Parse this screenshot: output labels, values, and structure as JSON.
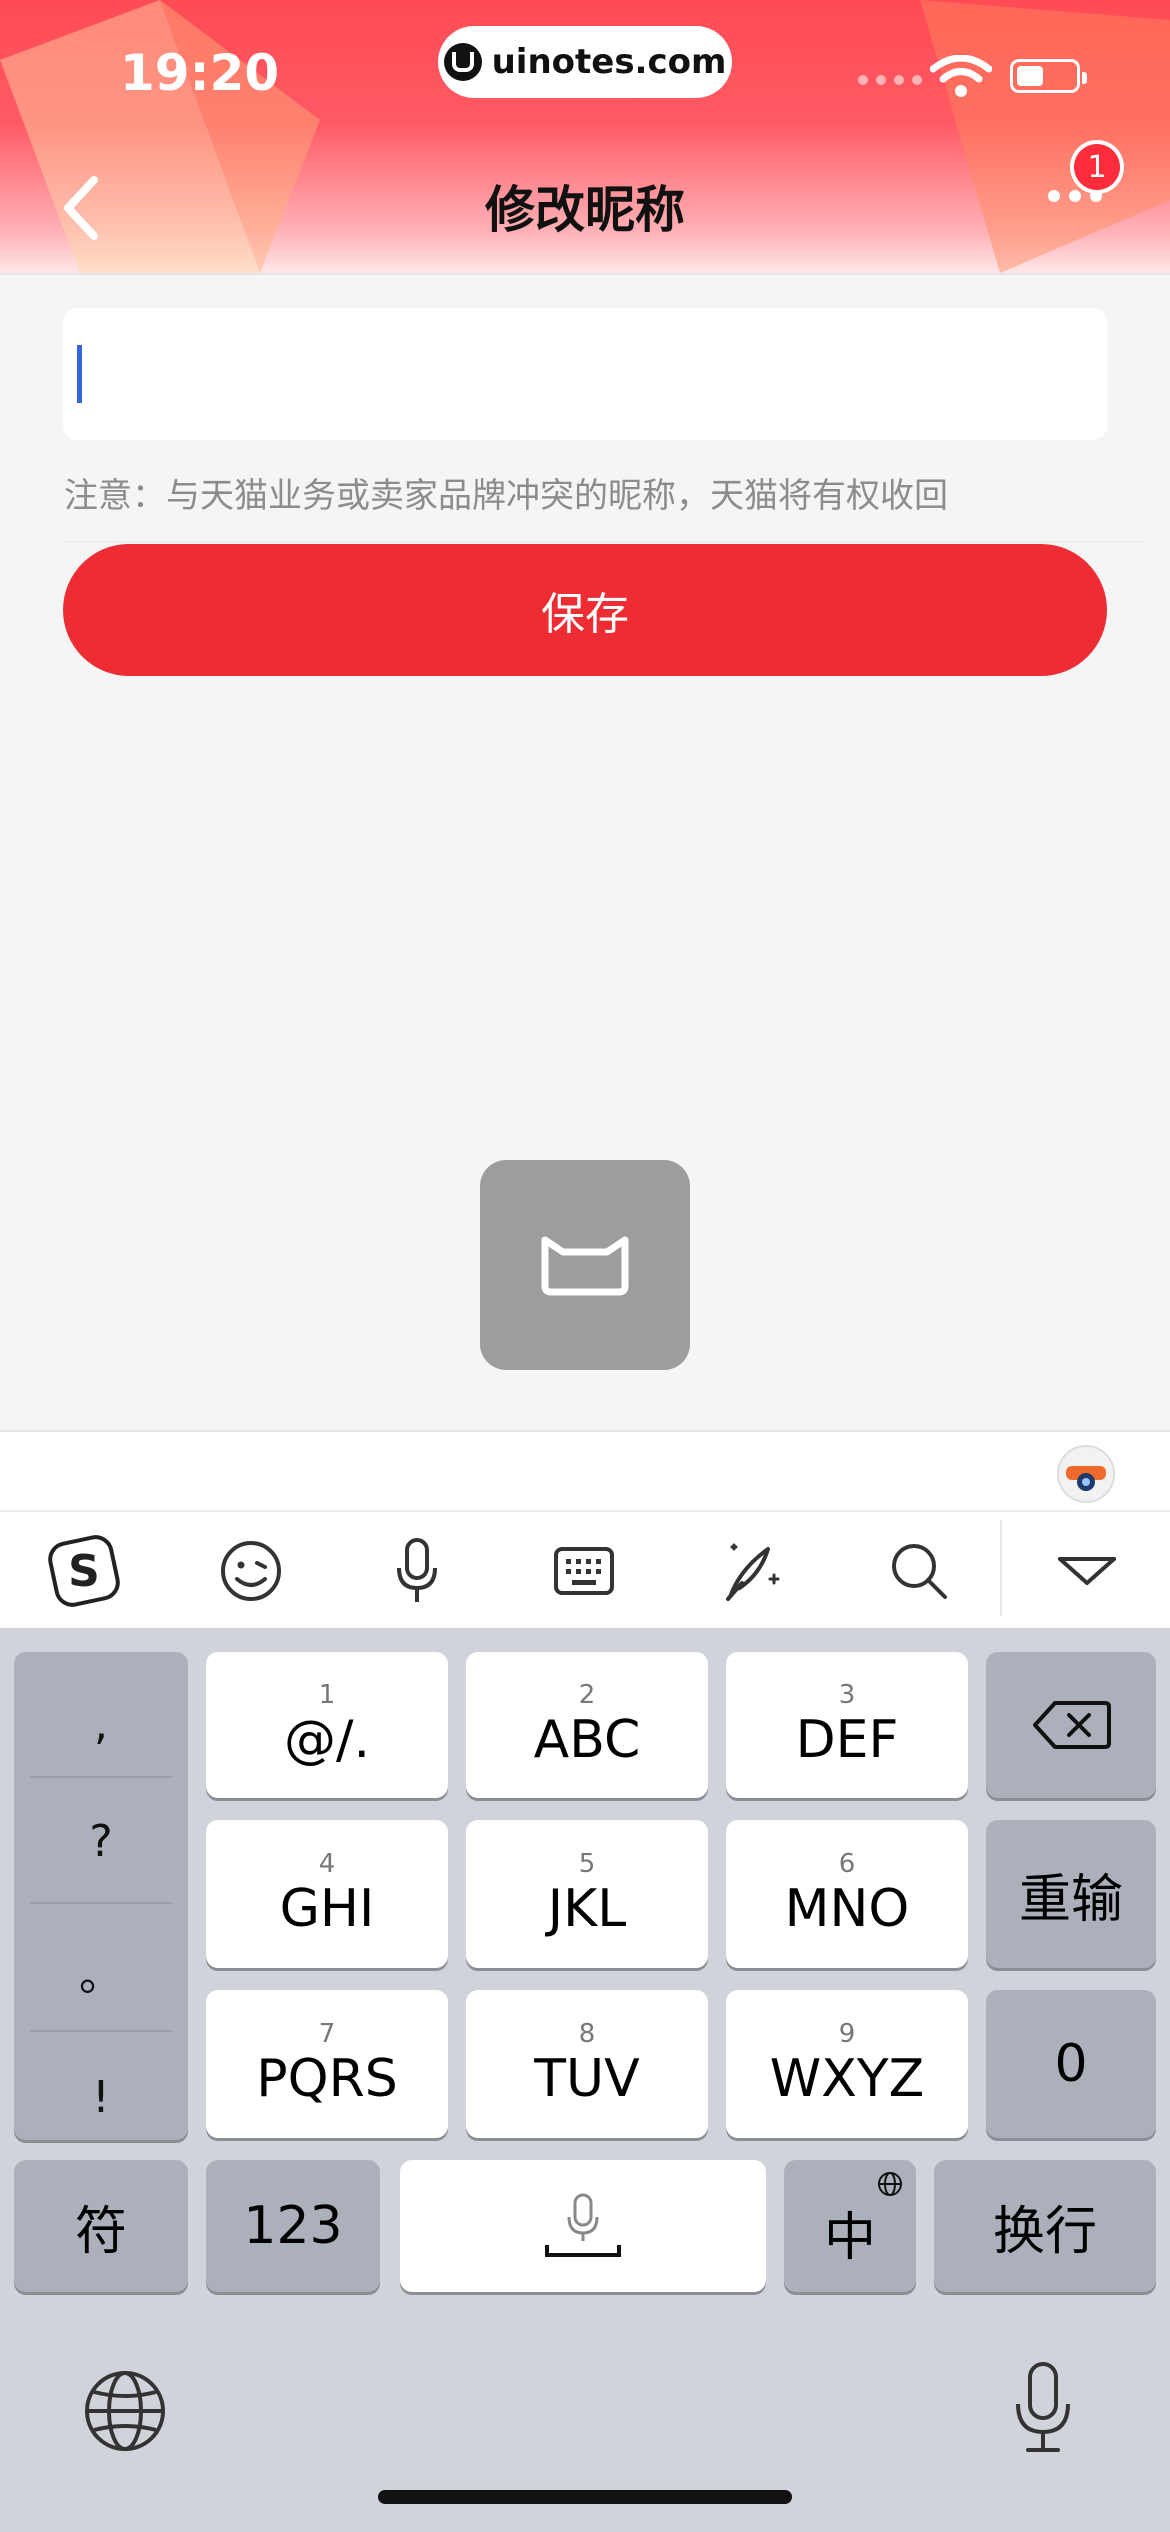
{
  "status_bar": {
    "time": "19:20",
    "url": "uinotes.com"
  },
  "nav": {
    "title": "修改昵称",
    "badge_count": "1"
  },
  "form": {
    "input_value": "",
    "input_placeholder": "",
    "note": "注意：与天猫业务或卖家品牌冲突的昵称，天猫将有权收回",
    "save_label": "保存"
  },
  "keyboard": {
    "toolbar_icons": [
      "sogou-logo-icon",
      "emoji-icon",
      "microphone-icon",
      "keyboard-icon",
      "handwriting-icon",
      "search-icon",
      "collapse-keyboard-icon"
    ],
    "punctuation": [
      ",",
      "?",
      "。",
      "!"
    ],
    "keys": [
      {
        "num": "1",
        "label": "@/."
      },
      {
        "num": "2",
        "label": "ABC"
      },
      {
        "num": "3",
        "label": "DEF"
      },
      {
        "num": "4",
        "label": "GHI"
      },
      {
        "num": "5",
        "label": "JKL"
      },
      {
        "num": "6",
        "label": "MNO"
      },
      {
        "num": "7",
        "label": "PQRS"
      },
      {
        "num": "8",
        "label": "TUV"
      },
      {
        "num": "9",
        "label": "WXYZ"
      }
    ],
    "reinput": "重输",
    "zero": "0",
    "symbols": "符",
    "numbers": "123",
    "chinese": "中",
    "newline": "换行"
  },
  "colors": {
    "brand_red": "#ee2c33",
    "caret": "#3366dd"
  }
}
